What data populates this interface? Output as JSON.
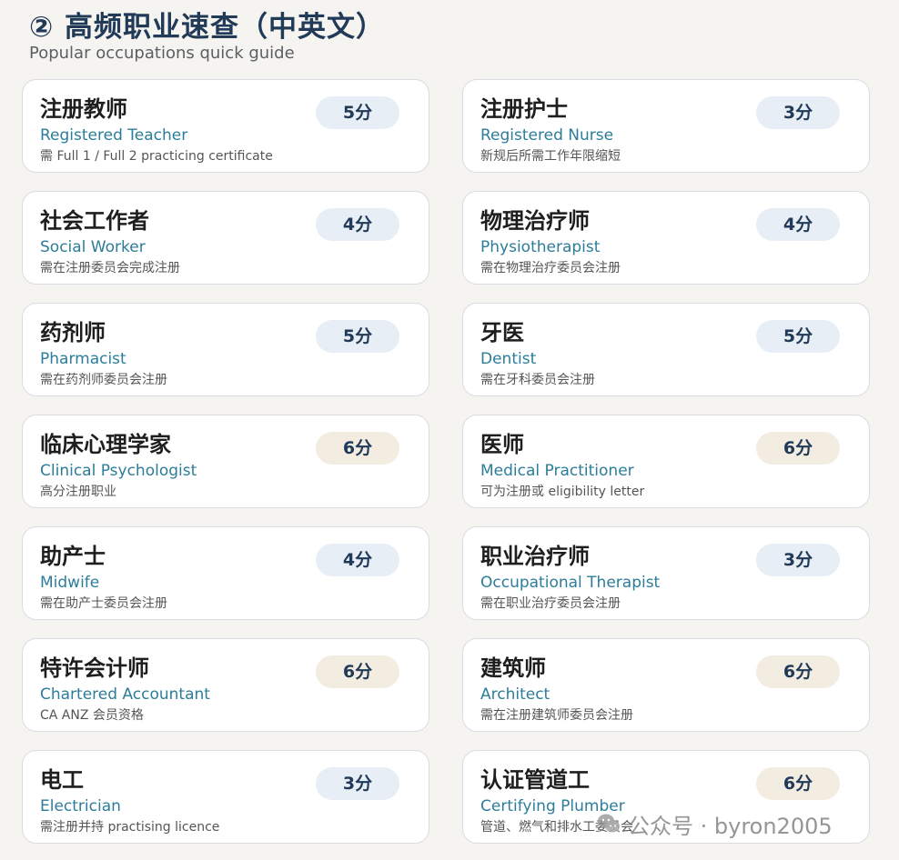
{
  "header": {
    "title": "② 高频职业速查（中英文）",
    "subtitle": "Popular occupations quick guide"
  },
  "cards": [
    {
      "zh": "注册教师",
      "en": "Registered Teacher",
      "note": "需 Full 1 / Full 2 practicing certificate",
      "badge": "5分"
    },
    {
      "zh": "注册护士",
      "en": "Registered Nurse",
      "note": "新规后所需工作年限缩短",
      "badge": "3分"
    },
    {
      "zh": "社会工作者",
      "en": "Social Worker",
      "note": "需在注册委员会完成注册",
      "badge": "4分"
    },
    {
      "zh": "物理治疗师",
      "en": "Physiotherapist",
      "note": "需在物理治疗委员会注册",
      "badge": "4分"
    },
    {
      "zh": "药剂师",
      "en": "Pharmacist",
      "note": "需在药剂师委员会注册",
      "badge": "5分"
    },
    {
      "zh": "牙医",
      "en": "Dentist",
      "note": "需在牙科委员会注册",
      "badge": "5分"
    },
    {
      "zh": "临床心理学家",
      "en": "Clinical Psychologist",
      "note": "高分注册职业",
      "badge": "6分"
    },
    {
      "zh": "医师",
      "en": "Medical Practitioner",
      "note": "可为注册或 eligibility letter",
      "badge": "6分"
    },
    {
      "zh": "助产士",
      "en": "Midwife",
      "note": "需在助产士委员会注册",
      "badge": "4分"
    },
    {
      "zh": "职业治疗师",
      "en": "Occupational Therapist",
      "note": "需在职业治疗委员会注册",
      "badge": "3分"
    },
    {
      "zh": "特许会计师",
      "en": "Chartered Accountant",
      "note": "CA ANZ 会员资格",
      "badge": "6分"
    },
    {
      "zh": "建筑师",
      "en": "Architect",
      "note": "需在注册建筑师委员会注册",
      "badge": "6分"
    },
    {
      "zh": "电工",
      "en": "Electrician",
      "note": "需注册并持 practising licence",
      "badge": "3分"
    },
    {
      "zh": "认证管道工",
      "en": "Certifying Plumber",
      "note": "管道、燃气和排水工委员会",
      "badge": "6分"
    }
  ],
  "watermark": {
    "text": "公众号 · byron2005",
    "icon": "wechat-icon"
  },
  "colors": {
    "title": "#213a57",
    "english": "#2c7d99",
    "badge_default": "#e7eef5",
    "badge_high": "#f2ece1"
  }
}
